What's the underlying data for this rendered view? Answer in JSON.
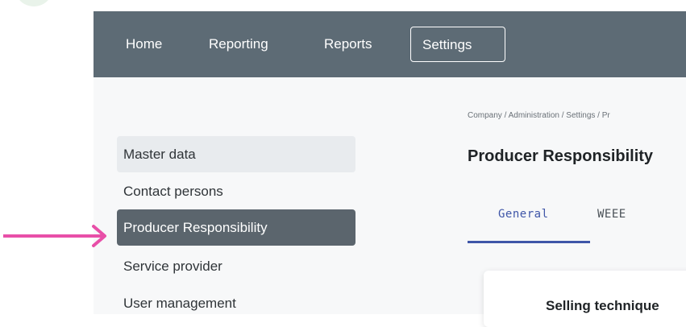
{
  "nav": {
    "items": [
      {
        "label": "Home"
      },
      {
        "label": "Reporting"
      },
      {
        "label": "Reports"
      },
      {
        "label": "Settings",
        "active": true
      }
    ]
  },
  "sidebar": {
    "items": [
      {
        "label": "Master data"
      },
      {
        "label": "Contact persons"
      },
      {
        "label": "Producer Responsibility",
        "active": true
      },
      {
        "label": "Service provider"
      },
      {
        "label": "User management"
      }
    ]
  },
  "main": {
    "breadcrumb": "Company / Administration / Settings / Pr",
    "title": "Producer Responsibility",
    "tabs": [
      {
        "label": "General",
        "active": true
      },
      {
        "label": "WEEE"
      }
    ],
    "card": {
      "title": "Selling technique"
    }
  },
  "colors": {
    "nav_bg": "#5d6b75",
    "sidebar_active_bg": "#5b656d",
    "tab_accent": "#3f56a8",
    "arrow": "#e84fa8"
  },
  "icons": {
    "pointer": "arrow-right-icon"
  }
}
